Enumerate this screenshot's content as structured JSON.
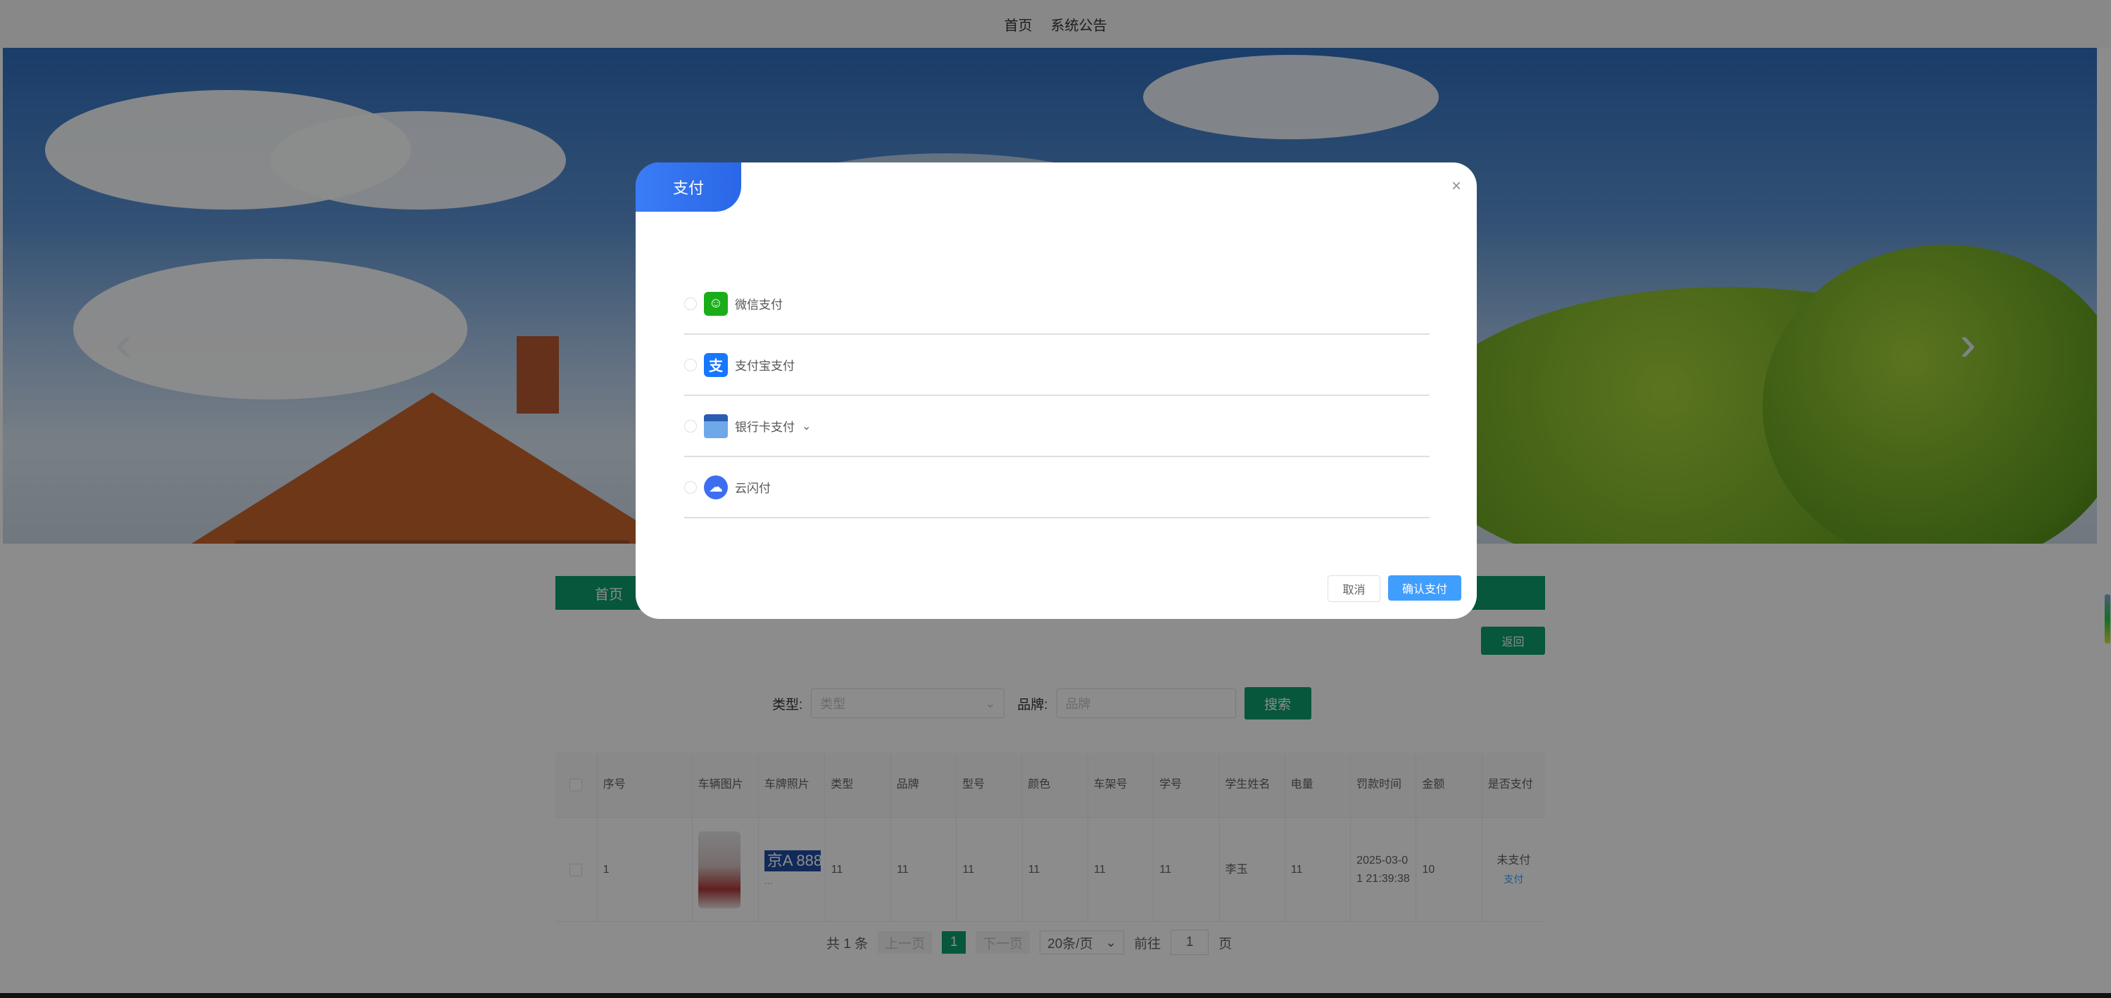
{
  "topnav": {
    "home": "首页",
    "notice": "系统公告"
  },
  "banner": {
    "prev_icon": "chevron-left-icon",
    "next_icon": "chevron-right-icon"
  },
  "breadcrumb": {
    "home": "首页"
  },
  "back_button": "返回",
  "search": {
    "type_label": "类型:",
    "type_placeholder": "类型",
    "brand_label": "品牌:",
    "brand_placeholder": "品牌",
    "button": "搜索"
  },
  "table": {
    "headers": [
      "序号",
      "车辆图片",
      "车牌照片",
      "类型",
      "品牌",
      "型号",
      "颜色",
      "车架号",
      "学号",
      "学生姓名",
      "电量",
      "罚款时间",
      "金额",
      "是否支付"
    ],
    "rows": [
      {
        "index": "1",
        "plate_text": "京A 888",
        "plate_more": "...",
        "type": "11",
        "brand": "11",
        "model": "11",
        "color": "11",
        "frame": "11",
        "student_id": "11",
        "student_name": "李玉",
        "battery": "11",
        "fine_time": "2025-03-01 21:39:38",
        "amount": "10",
        "paid_status": "未支付",
        "pay_link": "支付"
      }
    ]
  },
  "pagination": {
    "total": "共 1 条",
    "prev": "上一页",
    "current": "1",
    "next": "下一页",
    "page_size": "20条/页",
    "goto_label": "前往",
    "goto_value": "1",
    "page_unit": "页"
  },
  "modal": {
    "title": "支付",
    "close": "×",
    "options": [
      {
        "label": "微信支付",
        "icon": "wechat-pay-icon",
        "color": "#1aad19"
      },
      {
        "label": "支付宝支付",
        "icon": "alipay-icon",
        "color": "#1677ff"
      },
      {
        "label": "银行卡支付",
        "icon": "bank-card-icon",
        "color": "#3a7bd5"
      },
      {
        "label": "云闪付",
        "icon": "unionpay-cloud-icon",
        "color": "#3d6ef0"
      }
    ],
    "cancel": "取消",
    "confirm": "确认支付"
  },
  "colors": {
    "primary_green": "#0b9e6e",
    "modal_blue": "#3b7cf6",
    "confirm_blue": "#409eff"
  }
}
